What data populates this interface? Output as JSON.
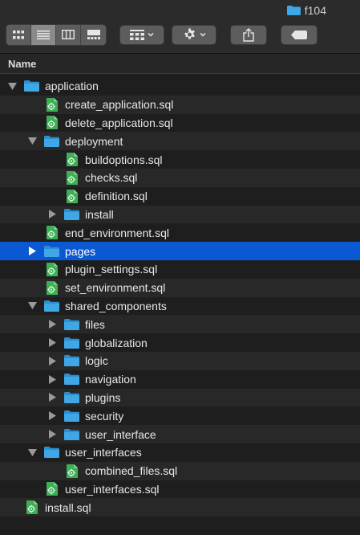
{
  "window": {
    "title": "f104"
  },
  "column_header": {
    "name": "Name"
  },
  "colors": {
    "folder": "#3fa7e6",
    "sql_icon": "#3fae56",
    "selection": "#0b59d2"
  },
  "rows": [
    {
      "label": "application",
      "depth": 0,
      "type": "folder",
      "state": "expanded"
    },
    {
      "label": "create_application.sql",
      "depth": 1,
      "type": "sql"
    },
    {
      "label": "delete_application.sql",
      "depth": 1,
      "type": "sql"
    },
    {
      "label": "deployment",
      "depth": 1,
      "type": "folder",
      "state": "expanded"
    },
    {
      "label": "buildoptions.sql",
      "depth": 2,
      "type": "sql"
    },
    {
      "label": "checks.sql",
      "depth": 2,
      "type": "sql"
    },
    {
      "label": "definition.sql",
      "depth": 2,
      "type": "sql"
    },
    {
      "label": "install",
      "depth": 2,
      "type": "folder",
      "state": "collapsed"
    },
    {
      "label": "end_environment.sql",
      "depth": 1,
      "type": "sql"
    },
    {
      "label": "pages",
      "depth": 1,
      "type": "folder",
      "state": "collapsed",
      "selected": true
    },
    {
      "label": "plugin_settings.sql",
      "depth": 1,
      "type": "sql"
    },
    {
      "label": "set_environment.sql",
      "depth": 1,
      "type": "sql"
    },
    {
      "label": "shared_components",
      "depth": 1,
      "type": "folder",
      "state": "expanded"
    },
    {
      "label": "files",
      "depth": 2,
      "type": "folder",
      "state": "collapsed"
    },
    {
      "label": "globalization",
      "depth": 2,
      "type": "folder",
      "state": "collapsed"
    },
    {
      "label": "logic",
      "depth": 2,
      "type": "folder",
      "state": "collapsed"
    },
    {
      "label": "navigation",
      "depth": 2,
      "type": "folder",
      "state": "collapsed"
    },
    {
      "label": "plugins",
      "depth": 2,
      "type": "folder",
      "state": "collapsed"
    },
    {
      "label": "security",
      "depth": 2,
      "type": "folder",
      "state": "collapsed"
    },
    {
      "label": "user_interface",
      "depth": 2,
      "type": "folder",
      "state": "collapsed"
    },
    {
      "label": "user_interfaces",
      "depth": 1,
      "type": "folder",
      "state": "expanded"
    },
    {
      "label": "combined_files.sql",
      "depth": 2,
      "type": "sql"
    },
    {
      "label": "user_interfaces.sql",
      "depth": 1,
      "type": "sql"
    },
    {
      "label": "install.sql",
      "depth": 0,
      "type": "sql"
    }
  ],
  "icons": {
    "view_icons": "icon-view-icon",
    "view_list": "list-view-icon",
    "view_columns": "column-view-icon",
    "view_gallery": "gallery-view-icon",
    "group": "group-grid-icon",
    "action": "gear-icon",
    "share": "share-icon",
    "tags": "tag-icon",
    "folder": "folder-icon",
    "sql": "sql-file-icon"
  }
}
